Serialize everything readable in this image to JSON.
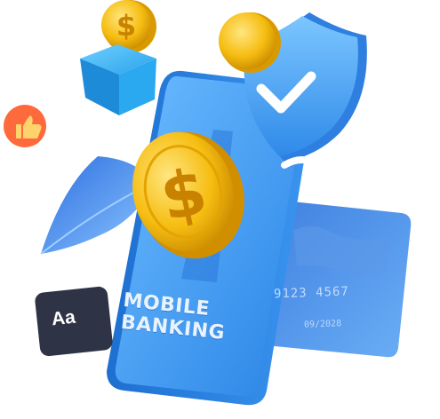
{
  "phone": {
    "line1": "MOBILE",
    "line2": "BANKING"
  },
  "card": {
    "number": "9123 4567",
    "date": "09/2028"
  },
  "font_badge": {
    "label": "Aa"
  },
  "icons": [
    "dollar-coin-icon",
    "shield-check-icon",
    "thumbs-up-icon",
    "cube-icon",
    "leaf-icon",
    "credit-card-icon",
    "font-icon"
  ],
  "colors": {
    "phone": "#3f9df2",
    "shield": "#4aa8f5",
    "coin": "#f2b90f",
    "cube": "#1f86d8",
    "thumb_bubble": "#ff6a3d",
    "font_badge": "#2e3445"
  }
}
